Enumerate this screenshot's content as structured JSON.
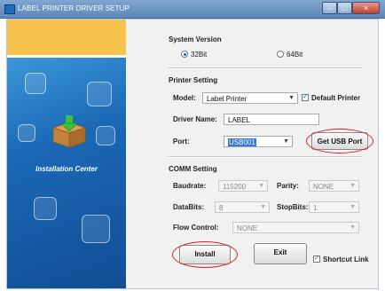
{
  "window": {
    "title": "LABEL PRINTER DRIVER SETUP"
  },
  "banner": {
    "label": "Installation Center",
    "icon": "box-download-icon"
  },
  "system_version": {
    "title": "System Version",
    "options": [
      {
        "label": "32Bit",
        "selected": true
      },
      {
        "label": "64Bit",
        "selected": false
      }
    ]
  },
  "printer_setting": {
    "title": "Printer Setting",
    "model_label": "Model:",
    "model_value": "Label Printer",
    "default_printer_label": "Default Printer",
    "default_printer_checked": true,
    "driver_name_label": "Driver Name:",
    "driver_name_value": "LABEL",
    "port_label": "Port:",
    "port_value": "USB001",
    "get_usb_port_label": "Get USB Port"
  },
  "comm_setting": {
    "title": "COMM Setting",
    "baudrate_label": "Baudrate:",
    "baudrate_value": "115200",
    "parity_label": "Parity:",
    "parity_value": "NONE",
    "databits_label": "DataBits:",
    "databits_value": "8",
    "stopbits_label": "StopBits:",
    "stopbits_value": "1",
    "flow_control_label": "Flow Control:",
    "flow_control_value": "NONE"
  },
  "actions": {
    "install_label": "Install",
    "exit_label": "Exit",
    "shortcut_link_label": "Shortcut Link",
    "shortcut_link_checked": true
  },
  "colors": {
    "highlight": "#d22222",
    "banner_blue": "#1b68b6",
    "banner_top": "#f6c44d"
  }
}
